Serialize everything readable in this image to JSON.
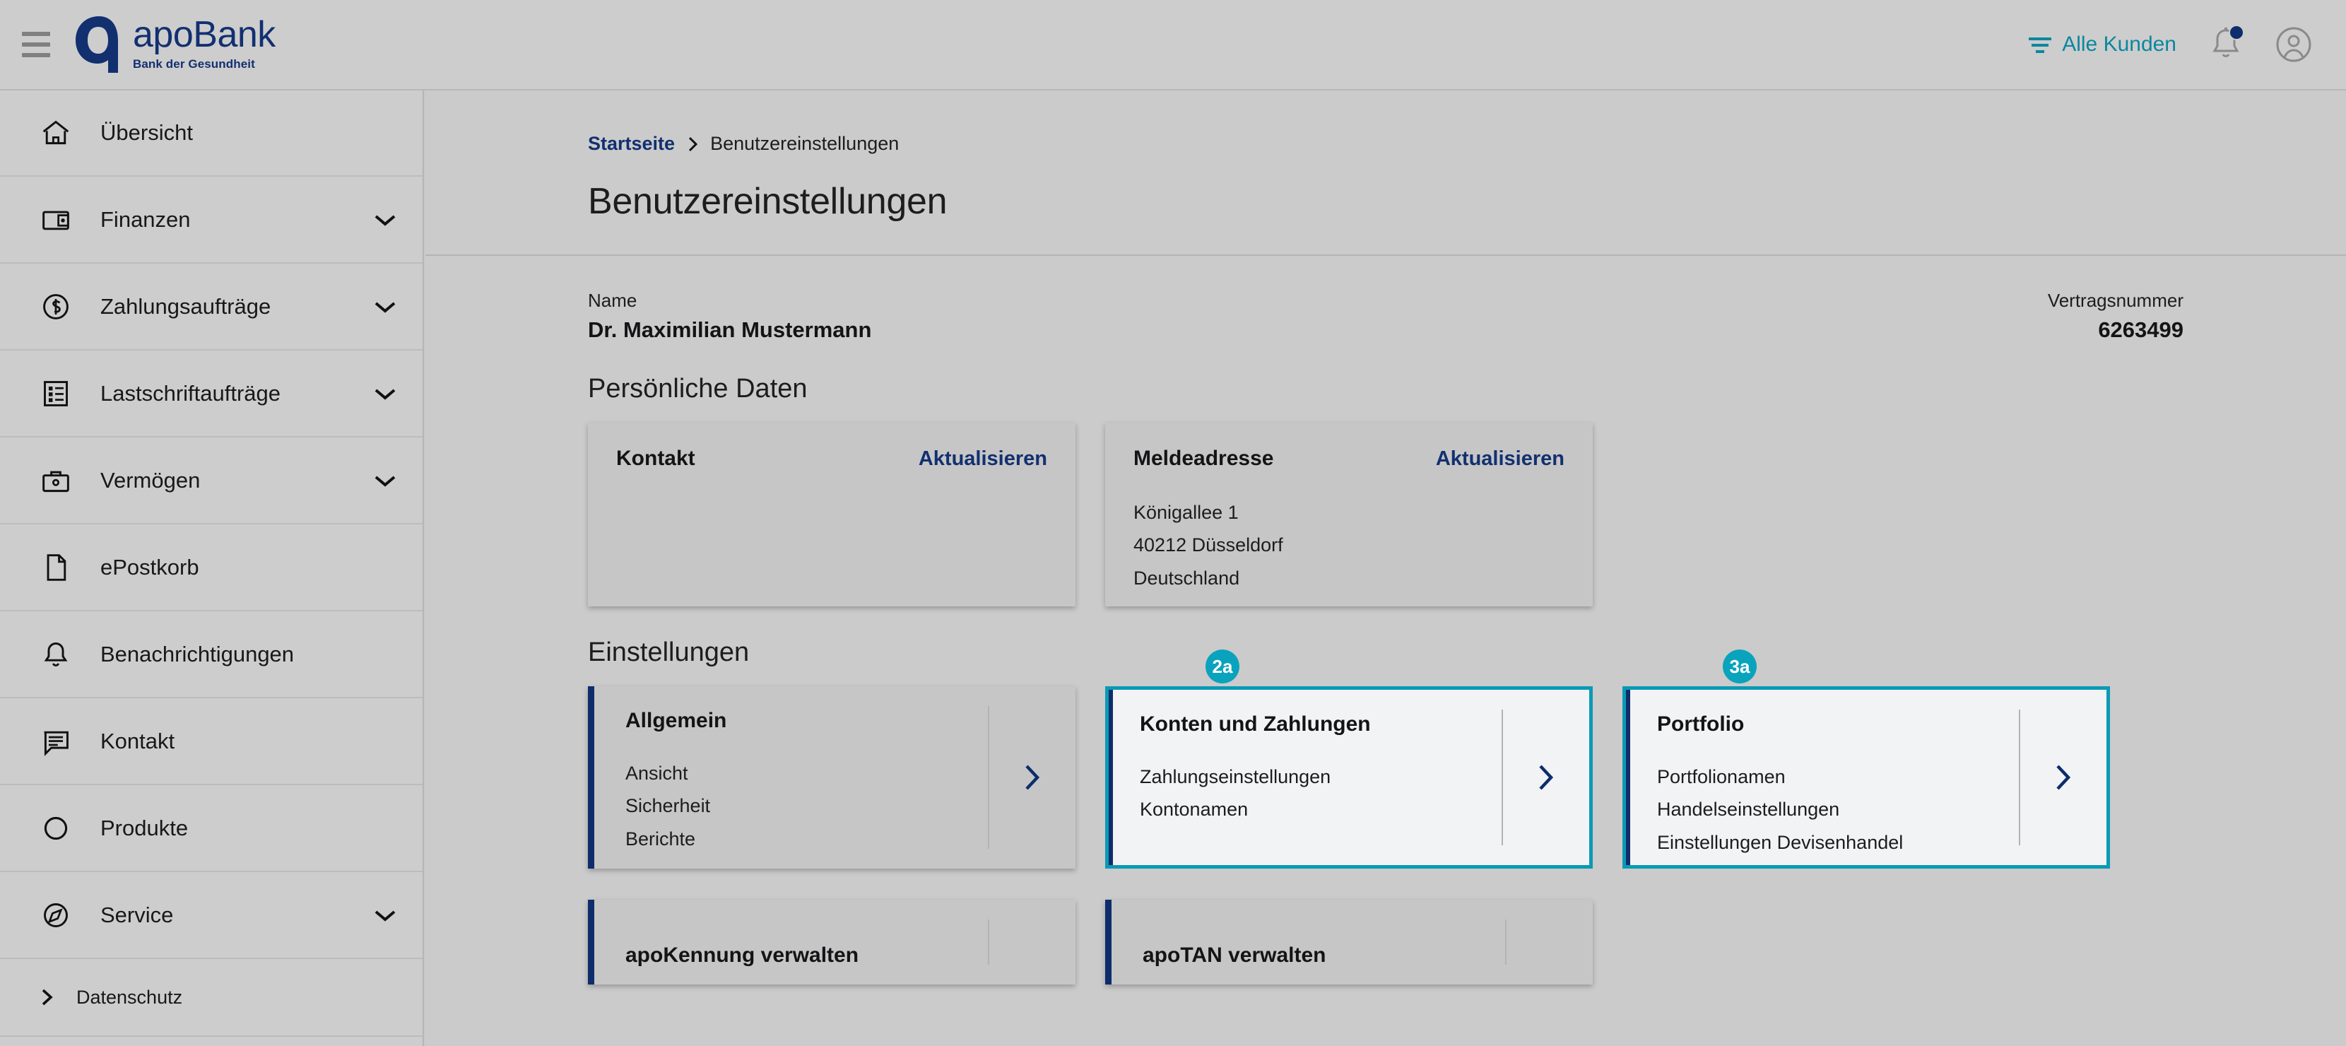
{
  "header": {
    "menu_icon": "hamburger-menu-icon",
    "logo": {
      "name": "apoBank",
      "tagline": "Bank der Gesundheit"
    },
    "all_customers_label": "Alle Kunden",
    "filter_icon": "filter-icon",
    "notifications_icon": "bell-icon",
    "account_icon": "user-account-icon",
    "has_notification_badge": true
  },
  "colors": {
    "brand_navy": "#123070",
    "accent_teal": "#0aa3bd",
    "highlight_border": "#0a9ab5",
    "page_bg": "#cbcbcb",
    "card_bg": "#c6c6c6",
    "card_bg_highlight": "#f2f3f5"
  },
  "sidebar": {
    "items": [
      {
        "label": "Übersicht",
        "icon": "home-icon",
        "expandable": false
      },
      {
        "label": "Finanzen",
        "icon": "wallet-icon",
        "expandable": true
      },
      {
        "label": "Zahlungsaufträge",
        "icon": "dollar-circle-icon",
        "expandable": true
      },
      {
        "label": "Lastschriftaufträge",
        "icon": "list-document-icon",
        "expandable": true
      },
      {
        "label": "Vermögen",
        "icon": "briefcase-icon",
        "expandable": true
      },
      {
        "label": "ePostkorb",
        "icon": "document-icon",
        "expandable": false
      },
      {
        "label": "Benachrichtigungen",
        "icon": "bell-icon",
        "expandable": false
      },
      {
        "label": "Kontakt",
        "icon": "chat-bubble-icon",
        "expandable": false
      },
      {
        "label": "Produkte",
        "icon": "circle-icon",
        "expandable": false
      },
      {
        "label": "Service",
        "icon": "compass-icon",
        "expandable": true
      }
    ],
    "footer_item": {
      "label": "Datenschutz",
      "icon": "chevron-right-icon"
    }
  },
  "main": {
    "breadcrumb": {
      "home": "Startseite",
      "separator_icon": "chevron-right-icon",
      "current": "Benutzereinstellungen"
    },
    "page_title": "Benutzereinstellungen",
    "meta": {
      "name_label": "Name",
      "name_value": "Dr. Maximilian Mustermann",
      "contract_label": "Vertragsnummer",
      "contract_value": "6263499"
    },
    "personal_section_title": "Persönliche Daten",
    "info_cards": [
      {
        "title": "Kontakt",
        "action": "Aktualisieren",
        "lines": []
      },
      {
        "title": "Meldeadresse",
        "action": "Aktualisieren",
        "lines": [
          "Königallee 1",
          "40212 Düsseldorf",
          "Deutschland"
        ]
      }
    ],
    "settings_section_title": "Einstellungen",
    "settings_cards": [
      {
        "title": "Allgemein",
        "items": [
          "Ansicht",
          "Sicherheit",
          "Berichte"
        ],
        "badge": null,
        "highlighted": false,
        "arrow_icon": "chevron-right-icon"
      },
      {
        "title": "Konten und Zahlungen",
        "items": [
          "Zahlungseinstellungen",
          "Kontonamen"
        ],
        "badge": "2a",
        "highlighted": true,
        "arrow_icon": "chevron-right-icon"
      },
      {
        "title": "Portfolio",
        "items": [
          "Portfolionamen",
          "Handelseinstellungen",
          "Einstellungen Devisenhandel"
        ],
        "badge": "3a",
        "highlighted": true,
        "arrow_icon": "chevron-right-icon"
      }
    ],
    "bottom_cards": [
      {
        "title": "apoKennung verwalten",
        "arrow_icon": "chevron-right-icon"
      },
      {
        "title": "apoTAN verwalten",
        "arrow_icon": "chevron-right-icon"
      }
    ]
  }
}
